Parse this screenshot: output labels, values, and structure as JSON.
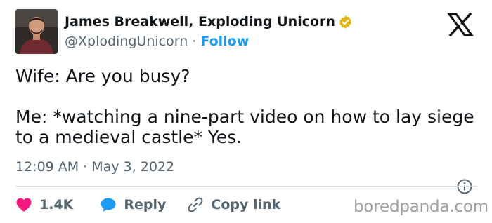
{
  "author": {
    "name": "James Breakwell, Exploding Unicorn",
    "handle": "@XplodingUnicorn",
    "separator": "·",
    "follow_label": "Follow",
    "verified_icon": "verified-badge-icon",
    "avatar_icon": "profile-photo"
  },
  "platform_icon": "x-logo-icon",
  "tweet": {
    "text": "Wife: Are you busy?\n\nMe: *watching a nine-part video on how to lay siege to a medieval castle* Yes.",
    "timestamp": "12:09 AM · May 3, 2022"
  },
  "actions": {
    "like_count": "1.4K",
    "like_icon": "heart-icon",
    "reply_label": "Reply",
    "reply_icon": "speech-bubble-icon",
    "copy_label": "Copy link",
    "copy_icon": "link-icon",
    "info_icon": "info-icon"
  },
  "watermark": "boredpanda.com",
  "colors": {
    "accent": "#1d9bf0",
    "like": "#f91880",
    "verified": "#e2b719",
    "muted": "#536471"
  }
}
